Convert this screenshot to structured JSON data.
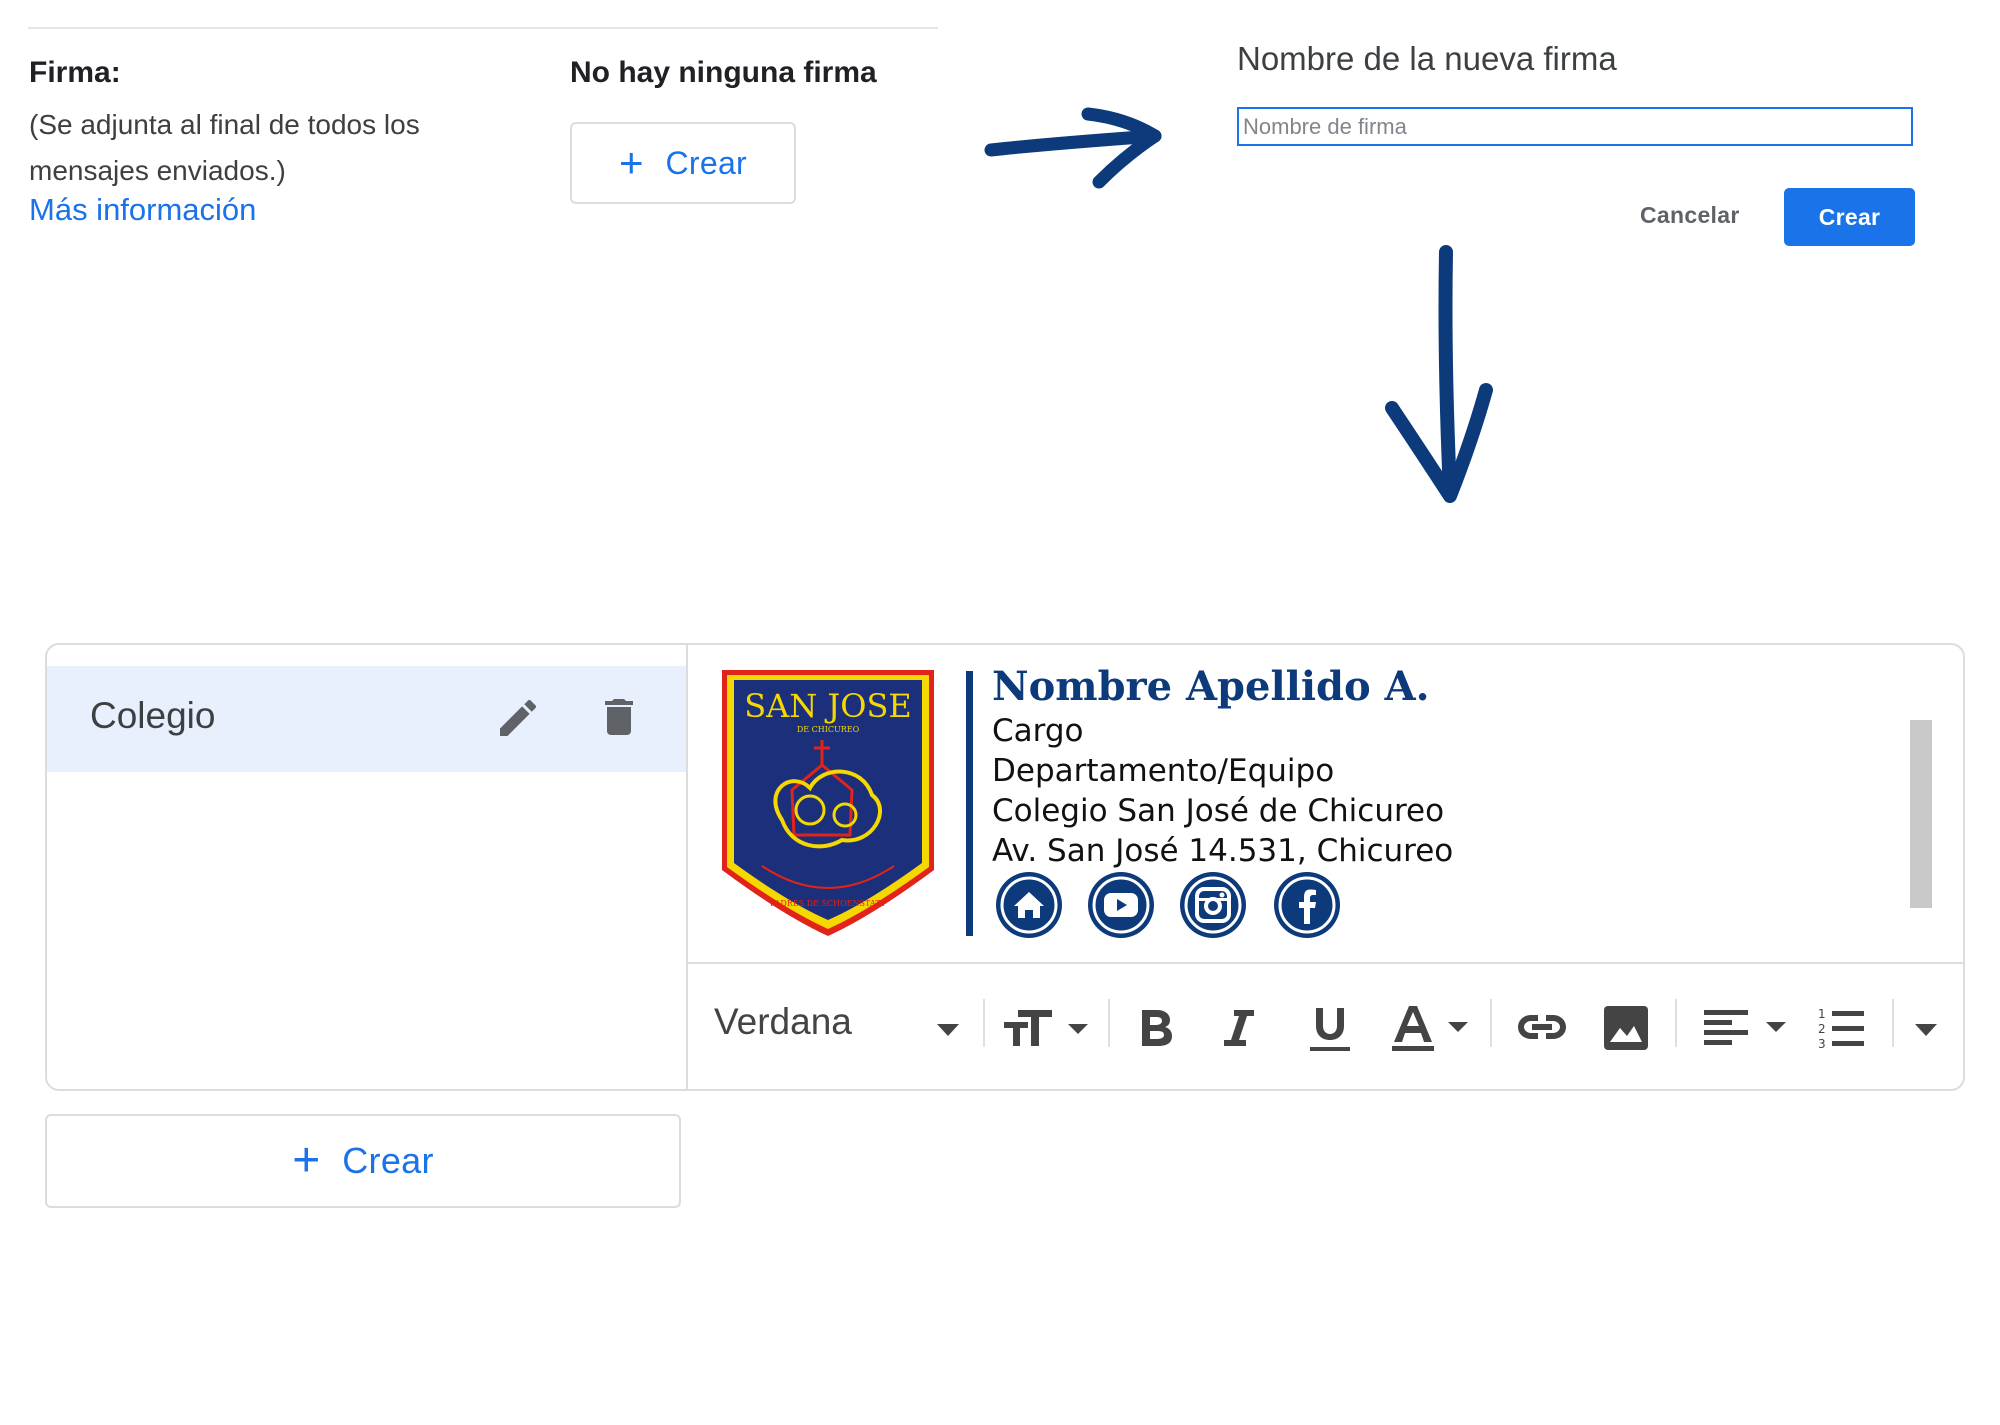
{
  "settings": {
    "label": "Firma:",
    "description": "(Se adjunta al final de todos los mensajes enviados.)",
    "more_info_link": "Más información",
    "empty_state": "No hay ninguna firma",
    "create_button": "Crear"
  },
  "dialog": {
    "title": "Nombre de la nueva firma",
    "input_placeholder": "Nombre de firma",
    "input_value": "",
    "cancel_button": "Cancelar",
    "create_button": "Crear"
  },
  "signature_list": {
    "items": [
      {
        "label": "Colegio",
        "edit_icon": "pencil-icon",
        "delete_icon": "trash-icon"
      }
    ],
    "create_button": "Crear"
  },
  "signature": {
    "logo": {
      "text_top": "SAN JOSE",
      "text_sub": "DE CHICUREO",
      "text_bottom": "PADRES DE SCHOENSTATT"
    },
    "name": "Nombre Apellido A.",
    "lines": [
      "Cargo",
      "Departamento/Equipo",
      "Colegio San José de Chicureo",
      "Av. San José 14.531, Chicureo"
    ],
    "social_icons": [
      "home-icon",
      "youtube-icon",
      "instagram-icon",
      "facebook-icon"
    ]
  },
  "toolbar": {
    "font_family": "Verdana",
    "buttons": [
      "font-size-icon",
      "bold-icon",
      "italic-icon",
      "underline-icon",
      "text-color-icon",
      "link-icon",
      "image-icon",
      "align-icon",
      "numbered-list-icon",
      "more-options-icon"
    ]
  },
  "colors": {
    "accent": "#1a73e8",
    "selected_row": "#e8f0fe",
    "brand_navy": "#0d3a7a",
    "arrow": "#0d3a7a",
    "crest_red": "#e2231a",
    "crest_yellow": "#f5d800"
  }
}
